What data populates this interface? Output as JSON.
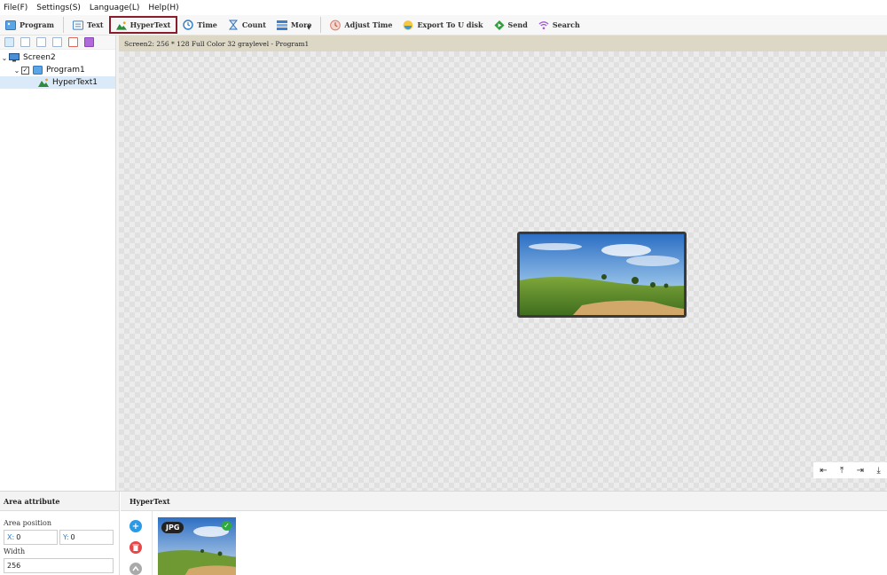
{
  "menubar": {
    "items": [
      "File(F)",
      "Settings(S)",
      "Language(L)",
      "Help(H)"
    ]
  },
  "toolbar": {
    "program": "Program",
    "text": "Text",
    "hypertext": "HyperText",
    "time": "Time",
    "count": "Count",
    "more": "More",
    "adjust_time": "Adjust Time",
    "export": "Export To U disk",
    "send": "Send",
    "search": "Search"
  },
  "tree": {
    "screen": "Screen2",
    "program": "Program1",
    "item": "HyperText1"
  },
  "status": {
    "text": "Screen2: 256 * 128 Full Color 32 graylevel - Program1"
  },
  "area_attribute": {
    "title": "Area attribute",
    "position_label": "Area position",
    "x_label": "X:",
    "x_value": "0",
    "y_label": "Y:",
    "y_value": "0",
    "width_label": "Width",
    "width_value": "256"
  },
  "hypertext_panel": {
    "title": "HyperText",
    "thumb_badge": "JPG"
  },
  "colors": {
    "active_border": "#8b1c2b",
    "status_strip": "#ddd7c6",
    "selected_row": "#dbeaf8"
  }
}
